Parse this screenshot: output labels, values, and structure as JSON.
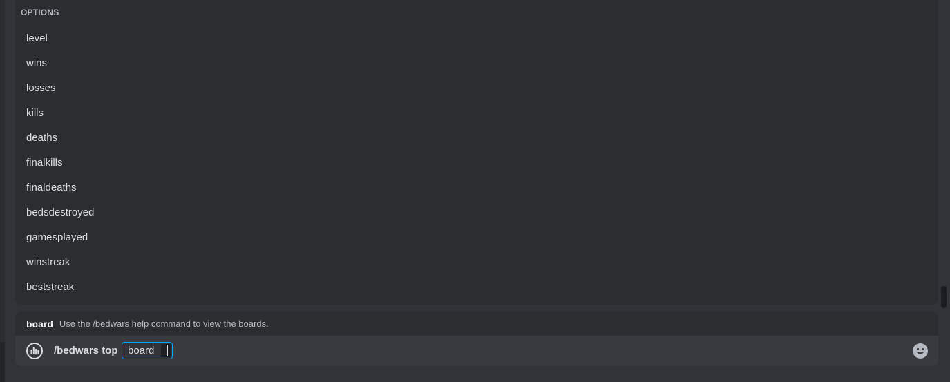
{
  "popup": {
    "header": "OPTIONS",
    "options": [
      {
        "label": "level"
      },
      {
        "label": "wins"
      },
      {
        "label": "losses"
      },
      {
        "label": "kills"
      },
      {
        "label": "deaths"
      },
      {
        "label": "finalkills"
      },
      {
        "label": "finaldeaths"
      },
      {
        "label": "bedsdestroyed"
      },
      {
        "label": "gamesplayed"
      },
      {
        "label": "winstreak"
      },
      {
        "label": "beststreak"
      }
    ]
  },
  "hint": {
    "name": "board",
    "description": "Use the /bedwars help command to view the boards."
  },
  "input": {
    "command": "/bedwars top",
    "param_label": "board",
    "app_icon": "bot-app-icon",
    "emoji_icon": "emoji-icon"
  },
  "colors": {
    "background": "#313338",
    "popup": "#2b2d31",
    "input": "#383a40",
    "accent": "#00a8fc",
    "text": "#dbdee1",
    "muted": "#b5bac1"
  }
}
